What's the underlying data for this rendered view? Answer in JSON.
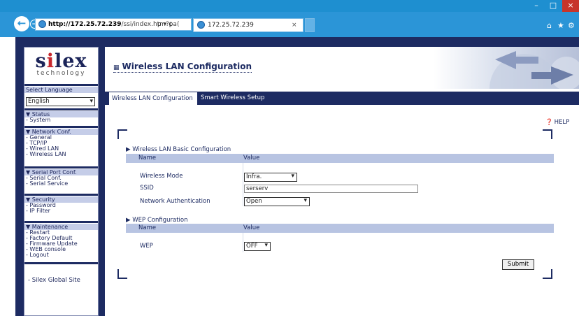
{
  "browser": {
    "url_host": "http://172.25.72.239",
    "url_path": "/ssi/index.htm?pa(",
    "tab_title": "172.25.72.239",
    "tab_close": "×",
    "address_icons": "ρ ▾ ¢",
    "minimize": "–",
    "maximize": "□",
    "close": "×",
    "home_icon": "⌂",
    "star_icon": "★",
    "gear_icon": "⚙"
  },
  "brand": {
    "name_pre": "s",
    "name_i": "i",
    "name_post": "lex",
    "sub": "technology"
  },
  "sidebar": {
    "select_language_label": "Select Language",
    "language_value": "English",
    "sections": [
      {
        "head": "▼ Status",
        "items": [
          "- System"
        ]
      },
      {
        "head": "▼ Network Conf.",
        "items": [
          "- General",
          "- TCP/IP",
          "- Wired LAN",
          "- Wireless LAN"
        ]
      },
      {
        "head": "▼ Serial Port Conf.",
        "items": [
          "- Serial Conf.",
          "- Serial Service"
        ]
      },
      {
        "head": "▼ Security",
        "items": [
          "- Password",
          "- IP Filter"
        ]
      },
      {
        "head": "▼ Maintenance",
        "items": [
          "- Restart",
          "- Factory Default",
          "- Firmware Update",
          "- WEB console",
          "- Logout"
        ]
      }
    ],
    "global_site": "- Silex Global Site"
  },
  "page": {
    "title": "Wireless LAN Configuration",
    "tabs": [
      "Wireless LAN Configuration",
      "Smart Wireless Setup"
    ],
    "help": "HELP",
    "basic": {
      "section_title": "▶ Wireless LAN Basic Configuration",
      "col_name": "Name",
      "col_value": "Value",
      "rows": [
        {
          "label": "Wireless Mode",
          "value": "Infra."
        },
        {
          "label": "SSID",
          "value": "serserv"
        },
        {
          "label": "Network Authentication",
          "value": "Open"
        }
      ]
    },
    "wep": {
      "section_title": "▶ WEP Configuration",
      "col_name": "Name",
      "col_value": "Value",
      "label": "WEP",
      "value": "OFF"
    },
    "submit": "Submit"
  }
}
